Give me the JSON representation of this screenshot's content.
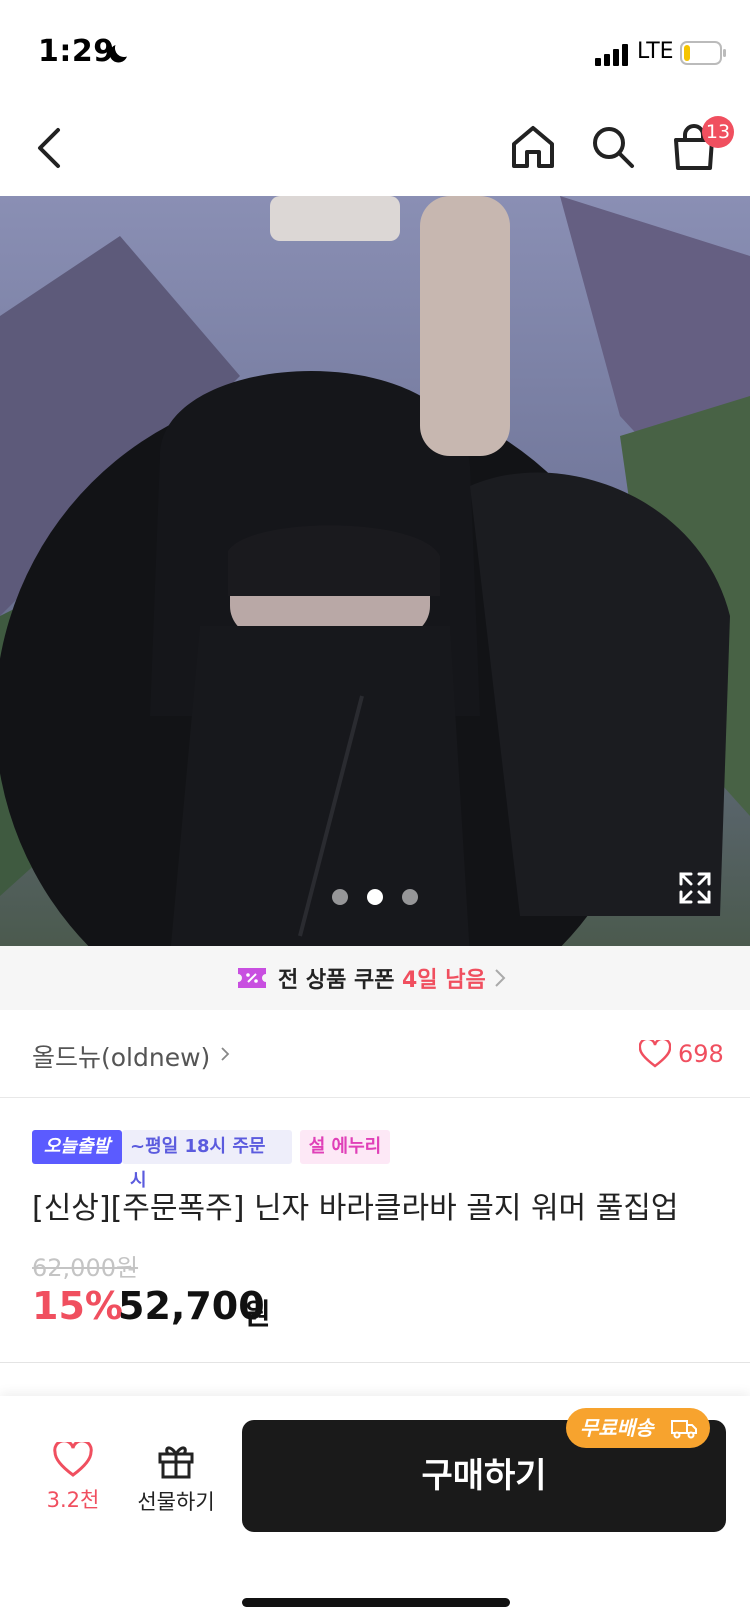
{
  "status_bar": {
    "time": "1:29",
    "network": "LTE"
  },
  "nav": {
    "cart_badge": "13"
  },
  "gallery": {
    "dots": 3,
    "active_dot": 2
  },
  "coupon": {
    "text": "전 상품 쿠폰",
    "remaining": "4일 남음"
  },
  "shop": {
    "name": "올드뉴(oldnew)",
    "likes": "698"
  },
  "tags": {
    "today": "오늘출발",
    "weekday": "~평일 18시 주문 시",
    "seol": "설 에누리"
  },
  "product": {
    "title": "[신상][주문폭주] 닌자 바라클라바 골지 워머 풀집업",
    "original_price": "62,000원",
    "discount_rate": "15%",
    "sale_price": "52,700",
    "price_unit": "원"
  },
  "bottom_bar": {
    "wish_count": "3.2천",
    "gift_label": "선물하기",
    "buy_label": "구매하기",
    "free_shipping": "무료배송"
  },
  "colors": {
    "accent": "#f04f5f",
    "tag_purple": "#5b5bff",
    "shipping_orange": "#f7a32e",
    "buy_black": "#1a1a1a"
  }
}
